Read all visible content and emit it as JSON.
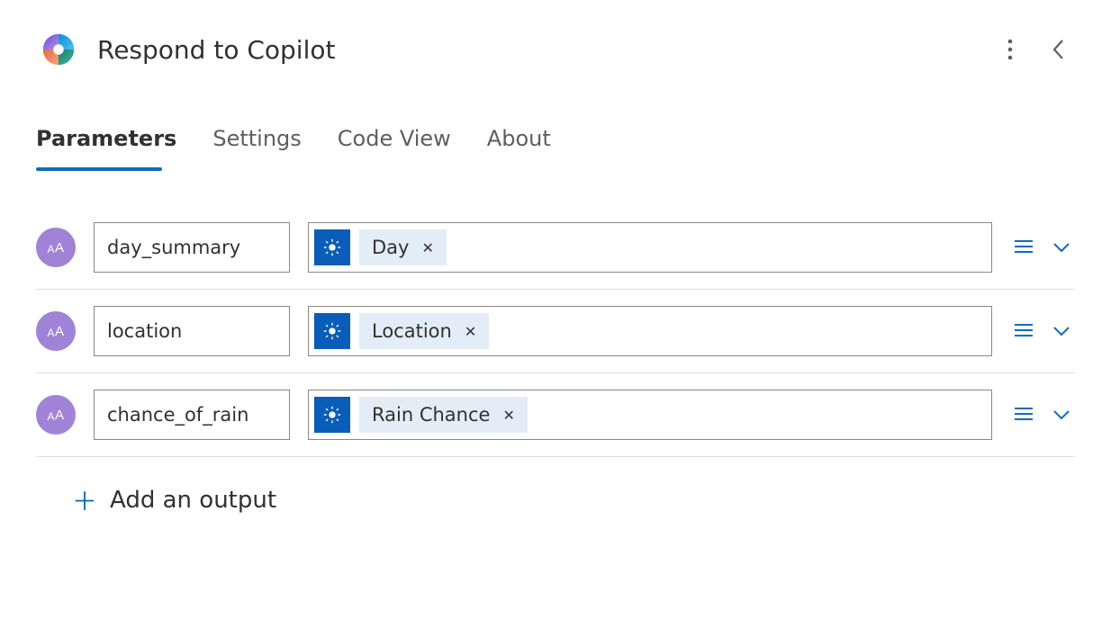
{
  "header": {
    "title": "Respond to Copilot"
  },
  "tabs": [
    {
      "label": "Parameters",
      "active": true
    },
    {
      "label": "Settings",
      "active": false
    },
    {
      "label": "Code View",
      "active": false
    },
    {
      "label": "About",
      "active": false
    }
  ],
  "type_badge_text": "AA",
  "parameters": [
    {
      "name": "day_summary",
      "token_label": "Day",
      "token_icon": "sun-icon"
    },
    {
      "name": "location",
      "token_label": "Location",
      "token_icon": "sun-icon"
    },
    {
      "name": "chance_of_rain",
      "token_label": "Rain Chance",
      "token_icon": "sun-icon"
    }
  ],
  "add_output_label": "Add an output",
  "colors": {
    "accent": "#0f6cbd",
    "badge": "#a083d6",
    "token_icon_bg": "#0a5db8",
    "token_label_bg": "#e3edf8"
  }
}
